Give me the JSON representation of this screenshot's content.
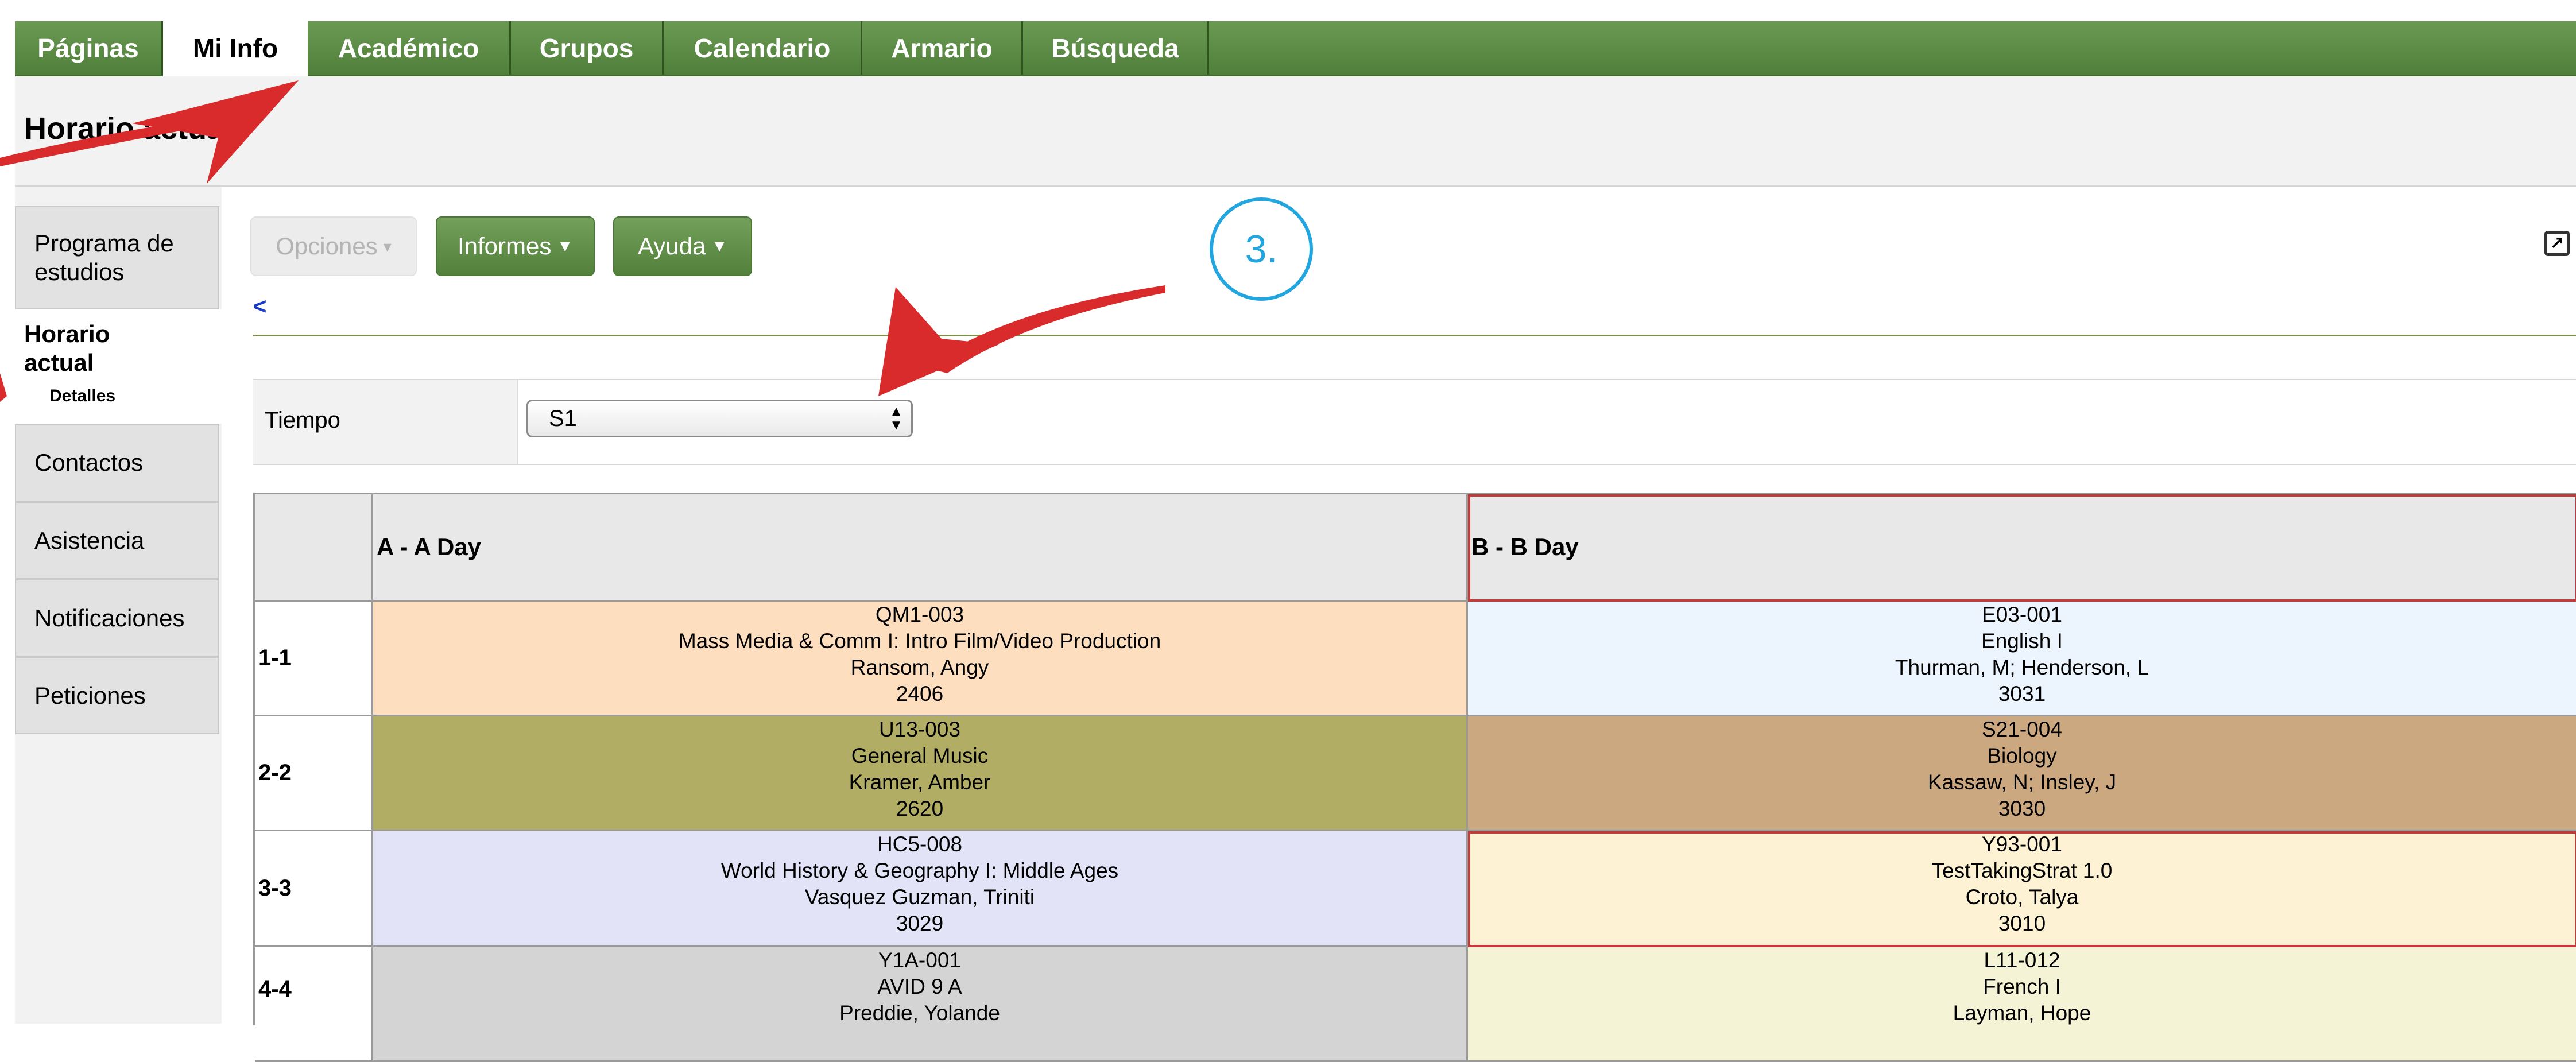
{
  "nav": {
    "tabs": [
      {
        "label": "Páginas"
      },
      {
        "label": "Mi Info"
      },
      {
        "label": "Académico"
      },
      {
        "label": "Grupos"
      },
      {
        "label": "Calendario"
      },
      {
        "label": "Armario"
      },
      {
        "label": "Búsqueda"
      }
    ]
  },
  "page": {
    "title": "Horario actual"
  },
  "sidebar": {
    "items": [
      {
        "label": "Programa de estudios"
      },
      {
        "label": "Horario actual",
        "sub": "Detalles"
      },
      {
        "label": "Contactos"
      },
      {
        "label": "Asistencia"
      },
      {
        "label": "Notificaciones"
      },
      {
        "label": "Peticiones"
      }
    ]
  },
  "toolbar": {
    "options_label": "Opciones",
    "reports_label": "Informes",
    "help_label": "Ayuda",
    "back_label": "<",
    "annotation_step": "3."
  },
  "filter": {
    "label": "Tiempo",
    "value": "S1"
  },
  "schedule": {
    "headers": [
      "A - A Day",
      "B - B Day"
    ],
    "rows": [
      {
        "period": "1-1",
        "a": {
          "code": "QM1-003",
          "title": "Mass Media & Comm I: Intro Film/Video Production",
          "teacher": "Ransom, Angy",
          "room": "2406",
          "color": "#fddfbf"
        },
        "b": {
          "code": "E03-001",
          "title": "English I",
          "teacher": "Thurman, M; Henderson, L",
          "room": "3031",
          "color": "#ecf4fd"
        }
      },
      {
        "period": "2-2",
        "a": {
          "code": "U13-003",
          "title": "General Music",
          "teacher": "Kramer, Amber",
          "room": "2620",
          "color": "#b1ad65"
        },
        "b": {
          "code": "S21-004",
          "title": "Biology",
          "teacher": "Kassaw, N; Insley, J",
          "room": "3030",
          "color": "#cca880"
        }
      },
      {
        "period": "3-3",
        "a": {
          "code": "HC5-008",
          "title": "World History & Geography I: Middle Ages",
          "teacher": "Vasquez Guzman, Triniti",
          "room": "3029",
          "color": "#e3e3f7"
        },
        "b": {
          "code": "Y93-001",
          "title": "TestTakingStrat 1.0",
          "teacher": "Croto, Talya",
          "room": "3010",
          "color": "#fdf3d4"
        }
      },
      {
        "period": "4-4",
        "a": {
          "code": "Y1A-001",
          "title": "AVID 9 A",
          "teacher": "Preddie, Yolande",
          "room": "",
          "color": "#d4d4d4"
        },
        "b": {
          "code": "L11-012",
          "title": "French I",
          "teacher": "Layman, Hope",
          "room": "",
          "color": "#f4f3d6"
        }
      }
    ]
  },
  "colors": {
    "nav_green": "#5a8a44",
    "annotation_red": "#d92b2b",
    "annotation_blue": "#21a6e0"
  }
}
